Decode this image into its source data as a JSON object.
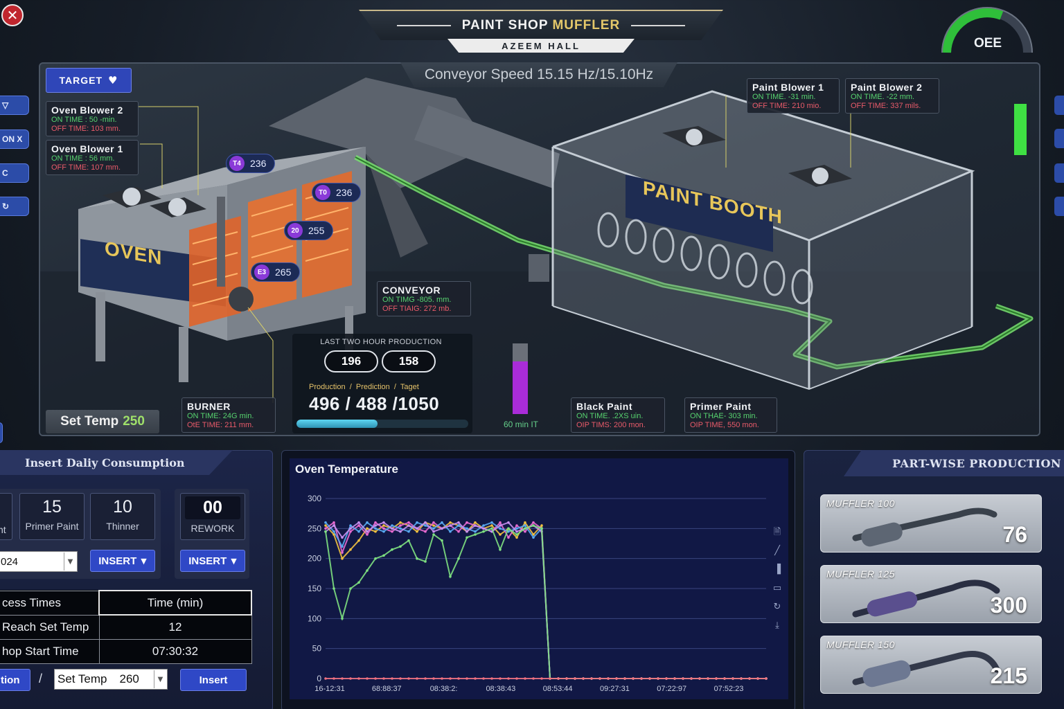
{
  "header": {
    "title_main": "PAINT SHOP",
    "title_accent": "MUFFLER",
    "subtitle": "AZEEM HALL",
    "oee_label": "OEE",
    "close_icon": "close-icon"
  },
  "left_stubs": [
    "▽",
    "ON X",
    "C",
    "↻"
  ],
  "scene": {
    "conveyor_speed": "Conveyor Speed 15.15 Hz/15.10Hz",
    "target_label": "TARGET",
    "oven_label": "OVEN",
    "paint_booth_label": "PAINT BOOTH",
    "set_temp_label": "Set Temp",
    "set_temp_value": "250",
    "cards": {
      "oven_blower_2": {
        "title": "Oven Blower 2",
        "on": "ON TIME : 50  -min.",
        "off": "OFF TIME: 103 mm."
      },
      "oven_blower_1": {
        "title": "Oven Blower 1",
        "on": "ON TIME : 56   mm.",
        "off": "OFF TIME: 107 mm."
      },
      "paint_blower_1": {
        "title": "Paint Blower 1",
        "on": "ON TIME. -31  min.",
        "off": "OFF TIME: 210 mio."
      },
      "paint_blower_2": {
        "title": "Paint Blower 2",
        "on": "ON TIME. -22  mm.",
        "off": "OFF TIME: 337 mils."
      },
      "conveyor": {
        "title": "CONVEYOR",
        "on": "ON TIMG -805. mm.",
        "off": "OFF TIAIG: 272 mb."
      },
      "burner": {
        "title": "BURNER",
        "on": "ON TIME: 24G min.",
        "off": "OtE TIME: 211  mm."
      },
      "black_paint": {
        "title": "Black Paint",
        "on": "ON TIME. .2XS uin.",
        "off": "OIP TIMS: 200 mon."
      },
      "primer_paint": {
        "title": "Primer Paint",
        "on": "ON THAE- 303 min.",
        "off": "OIP TIME, 550 mon."
      }
    },
    "temps": [
      {
        "badge": "T4",
        "value": "236"
      },
      {
        "badge": "T0",
        "value": "236"
      },
      {
        "badge": "20",
        "value": "255"
      },
      {
        "badge": "E3",
        "value": "265"
      }
    ],
    "production": {
      "header": "LAST TWO HOUR PRODUCTION",
      "hour1": "196",
      "hour2": "158",
      "sub_production": "Production",
      "sub_prediction": "Prediction",
      "sub_target": "Taget",
      "numbers": "496  /  488  /1050",
      "progress": 0.47
    },
    "vbar": {
      "label": "60 min IT",
      "level": 0.75
    },
    "green_meter_level": 1.0
  },
  "consumption": {
    "title": "Insert Daliy Consumption",
    "primer_value": "15",
    "primer_label": "Primer Paint",
    "thinner_value": "10",
    "thinner_label": "Thinner",
    "partial_label": "nt",
    "rework_value": "00",
    "rework_label": "REWORK",
    "date_value": "024",
    "insert_label": "INSERT",
    "table": {
      "header_left": "cess Times",
      "header_right": "Time (min)",
      "rows": [
        {
          "label": "Reach Set Temp",
          "value": "12"
        },
        {
          "label": "hop Start Time",
          "value": "07:30:32"
        }
      ]
    },
    "bottom_left_label": "tion",
    "slash": "/",
    "settemp_label": "Set Temp",
    "settemp_value": "260",
    "insert_button": "Insert"
  },
  "chart_data": {
    "type": "line",
    "title": "Oven Temperature",
    "xlabel": "",
    "ylabel": "",
    "ylim": [
      0,
      300
    ],
    "yticks": [
      0,
      50,
      100,
      150,
      200,
      250,
      300
    ],
    "xtick_labels": [
      "16-12:31",
      "68:88:37",
      "08:38:2:",
      "08:38:43",
      "08:53:44",
      "09:27:31",
      "07:22:97",
      "07:52:23"
    ],
    "legend": "none",
    "grid": true,
    "series": [
      {
        "color": "#f0c040",
        "values": [
          255,
          240,
          200,
          215,
          230,
          250,
          245,
          255,
          250,
          260,
          255,
          245,
          260,
          255,
          250,
          260,
          255,
          245,
          260,
          250,
          255,
          240,
          250,
          235,
          260,
          240,
          255,
          0,
          0,
          0,
          0,
          0,
          0,
          0,
          0,
          0,
          0,
          0,
          0,
          0,
          0,
          0,
          0,
          0,
          0,
          0,
          0,
          0,
          0,
          0,
          0,
          0,
          0,
          0
        ]
      },
      {
        "color": "#e86ad0",
        "values": [
          250,
          260,
          210,
          245,
          255,
          240,
          260,
          250,
          245,
          255,
          260,
          250,
          245,
          260,
          250,
          255,
          245,
          260,
          255,
          250,
          245,
          260,
          235,
          255,
          245,
          260,
          250,
          0,
          0,
          0,
          0,
          0,
          0,
          0,
          0,
          0,
          0,
          0,
          0,
          0,
          0,
          0,
          0,
          0,
          0,
          0,
          0,
          0,
          0,
          0,
          0,
          0,
          0,
          0
        ]
      },
      {
        "color": "#58a8f0",
        "values": [
          260,
          245,
          220,
          255,
          245,
          260,
          250,
          245,
          255,
          250,
          245,
          260,
          255,
          250,
          260,
          245,
          255,
          250,
          245,
          255,
          260,
          250,
          245,
          250,
          255,
          235,
          250,
          0,
          0,
          0,
          0,
          0,
          0,
          0,
          0,
          0,
          0,
          0,
          0,
          0,
          0,
          0,
          0,
          0,
          0,
          0,
          0,
          0,
          0,
          0,
          0,
          0,
          0,
          0
        ]
      },
      {
        "color": "#c890f0",
        "values": [
          245,
          255,
          235,
          250,
          260,
          245,
          255,
          260,
          250,
          245,
          255,
          250,
          260,
          245,
          250,
          255,
          260,
          245,
          255,
          250,
          245,
          255,
          260,
          245,
          250,
          255,
          245,
          0,
          0,
          0,
          0,
          0,
          0,
          0,
          0,
          0,
          0,
          0,
          0,
          0,
          0,
          0,
          0,
          0,
          0,
          0,
          0,
          0,
          0,
          0,
          0,
          0,
          0,
          0
        ]
      },
      {
        "color": "#7ee080",
        "values": [
          245,
          150,
          100,
          150,
          160,
          180,
          200,
          205,
          215,
          220,
          230,
          200,
          195,
          240,
          230,
          170,
          200,
          235,
          240,
          245,
          250,
          215,
          250,
          240,
          250,
          255,
          250,
          0,
          0,
          0,
          0,
          0,
          0,
          0,
          0,
          0,
          0,
          0,
          0,
          0,
          0,
          0,
          0,
          0,
          0,
          0,
          0,
          0,
          0,
          0,
          0,
          0,
          0,
          0
        ]
      },
      {
        "color": "#f07080",
        "values": [
          0,
          0,
          0,
          0,
          0,
          0,
          0,
          0,
          0,
          0,
          0,
          0,
          0,
          0,
          0,
          0,
          0,
          0,
          0,
          0,
          0,
          0,
          0,
          0,
          0,
          0,
          0,
          0,
          0,
          0,
          0,
          0,
          0,
          0,
          0,
          0,
          0,
          0,
          0,
          0,
          0,
          0,
          0,
          0,
          0,
          0,
          0,
          0,
          0,
          0,
          0,
          0,
          0,
          0
        ]
      }
    ],
    "toolbar_icons": [
      "save-icon",
      "line-chart-icon",
      "bar-chart-icon",
      "data-view-icon",
      "refresh-icon",
      "download-icon"
    ]
  },
  "parts": {
    "title": "PART-WISE PRODUCTION",
    "items": [
      {
        "name": "MUFFLER 100",
        "value": "76"
      },
      {
        "name": "MUFFLER 125",
        "value": "300"
      },
      {
        "name": "MUFFLER 150",
        "value": "215"
      }
    ]
  }
}
